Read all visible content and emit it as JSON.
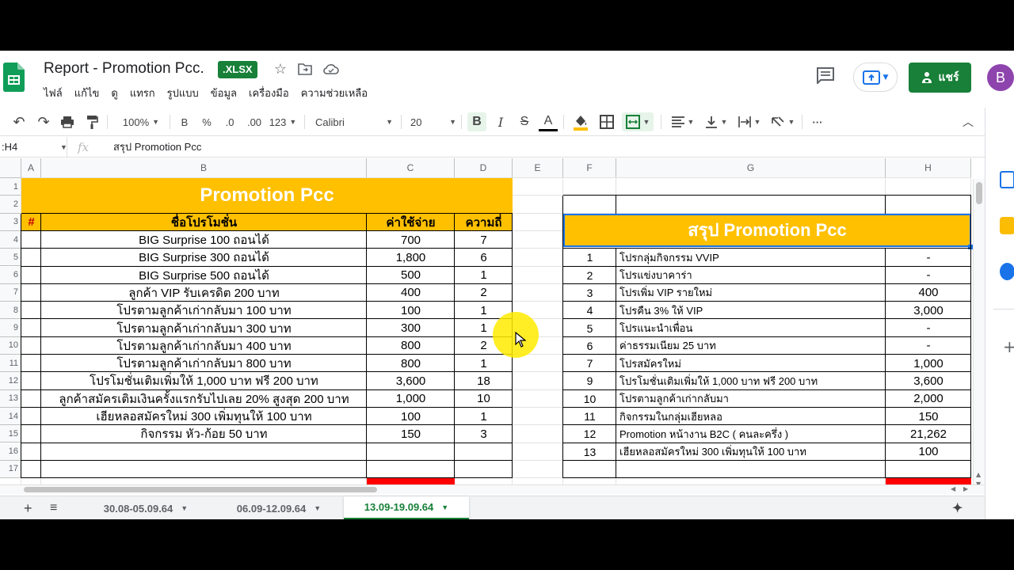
{
  "app": {
    "doc_title": "Report - Promotion Pcc.",
    "badge": ".XLSX",
    "menu": [
      "ไฟล์",
      "แก้ไข",
      "ดู",
      "แทรก",
      "รูปแบบ",
      "ข้อมูล",
      "เครื่องมือ",
      "ความช่วยเหลือ"
    ],
    "share_label": "แชร์",
    "avatar_letter": "B"
  },
  "toolbar": {
    "zoom": "100%",
    "currency": "B",
    "percent": "%",
    "dec_decrease": ".0",
    "dec_increase": ".00",
    "format_more": "123",
    "font": "Calibri",
    "font_size": "20",
    "bold": "B",
    "italic": "I",
    "strike": "S",
    "text_color": "A",
    "more": "···"
  },
  "formula_bar": {
    "name_box": ":H4",
    "fx": "fx",
    "value": "สรุป Promotion Pcc"
  },
  "columns": [
    "A",
    "B",
    "C",
    "D",
    "E",
    "F",
    "G",
    "H"
  ],
  "rows": [
    "1",
    "2",
    "3",
    "4",
    "5",
    "6",
    "7",
    "8",
    "9",
    "10",
    "11",
    "12",
    "13",
    "14",
    "15",
    "16",
    "17"
  ],
  "left_table": {
    "title": "Promotion Pcc",
    "headers": [
      "#",
      "ชื่อโปรโมชั่น",
      "ค่าใช้จ่าย",
      "ความถี่"
    ],
    "rows": [
      {
        "name": "BIG Surprise 100 ถอนได้",
        "cost": "700",
        "freq": "7"
      },
      {
        "name": "BIG Surprise 300 ถอนได้",
        "cost": "1,800",
        "freq": "6"
      },
      {
        "name": "BIG Surprise 500 ถอนได้",
        "cost": "500",
        "freq": "1"
      },
      {
        "name": "ลูกค้า VIP รับเครดิต 200 บาท",
        "cost": "400",
        "freq": "2"
      },
      {
        "name": "โปรตามลูกค้าเก่ากลับมา 100 บาท",
        "cost": "100",
        "freq": "1"
      },
      {
        "name": "โปรตามลูกค้าเก่ากลับมา 300 บาท",
        "cost": "300",
        "freq": "1"
      },
      {
        "name": "โปรตามลูกค้าเก่ากลับมา 400 บาท",
        "cost": "800",
        "freq": "2"
      },
      {
        "name": "โปรตามลูกค้าเก่ากลับมา 800 บาท",
        "cost": "800",
        "freq": "1"
      },
      {
        "name": "โปรโมชั่นเติมเพิ่มให้ 1,000 บาท ฟรี 200 บาท",
        "cost": "3,600",
        "freq": "18"
      },
      {
        "name": "ลูกค้าสมัครเติมเงินครั้งแรกรับไปเลย 20% สูงสุด 200 บาท",
        "cost": "1,000",
        "freq": "10"
      },
      {
        "name": "เฮียหลอสมัครใหม่ 300 เพิ่มทุนให้ 100 บาท",
        "cost": "100",
        "freq": "1"
      },
      {
        "name": "กิจกรรม หัว-ก้อย 50 บาท",
        "cost": "150",
        "freq": "3"
      }
    ]
  },
  "right_table": {
    "title": "สรุป Promotion Pcc",
    "rows": [
      {
        "no": "1",
        "name": "โปรกลุ่มกิจกรรม VVIP",
        "value": "-"
      },
      {
        "no": "2",
        "name": "โปรแข่งบาคาร่า",
        "value": "-"
      },
      {
        "no": "3",
        "name": "โปรเพิ่ม VIP รายใหม่",
        "value": "400"
      },
      {
        "no": "4",
        "name": "โปรคืน 3% ให้ VIP",
        "value": "3,000"
      },
      {
        "no": "5",
        "name": "โปรแนะนำเพื่อน",
        "value": "-"
      },
      {
        "no": "6",
        "name": "ค่าธรรมเนียม 25 บาท",
        "value": "-"
      },
      {
        "no": "7",
        "name": "โปรสมัครใหม่",
        "value": "1,000"
      },
      {
        "no": "9",
        "name": "โปรโมชั่นเติมเพิ่มให้ 1,000 บาท ฟรี 200 บาท",
        "value": "3,600"
      },
      {
        "no": "10",
        "name": "โปรตามลูกค้าเก่ากลับมา",
        "value": "2,000"
      },
      {
        "no": "11",
        "name": "กิจกรรมในกลุ่มเฮียหลอ",
        "value": "150"
      },
      {
        "no": "12",
        "name": "Promotion หน้างาน B2C ( คนละครึ่ง )",
        "value": "21,262"
      },
      {
        "no": "13",
        "name": "เฮียหลอสมัครใหม่ 300 เพิ่มทุนให้ 100 บาท",
        "value": "100"
      }
    ]
  },
  "sheets": [
    "30.08-05.09.64",
    "06.09-12.09.64",
    "13.09-19.09.64"
  ],
  "colors": {
    "accent": "#188038",
    "header_fill": "#ffc000",
    "red": "#ff0000"
  }
}
